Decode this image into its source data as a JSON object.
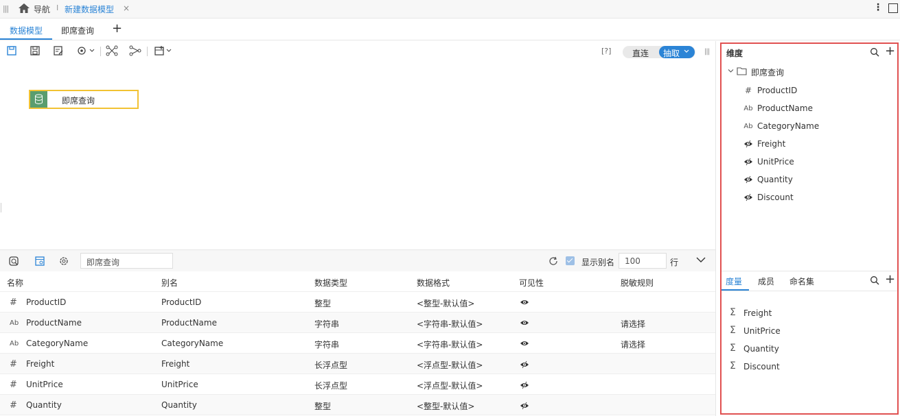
{
  "topbar": {
    "nav_label": "导航",
    "separator": "I",
    "open_tab": "新建数据模型",
    "close_glyph": "×"
  },
  "tabs": {
    "model": "数据模型",
    "adhoc": "即席查询",
    "add": "+"
  },
  "canvas": {
    "help": "[?]",
    "mode": {
      "direct": "直连",
      "extract": "抽取"
    },
    "node_label": "即席查询"
  },
  "bottom": {
    "search_value": "即席查询",
    "show_alias_label": "显示别名",
    "show_alias_checked": true,
    "row_limit": "100",
    "row_unit": "行",
    "columns": [
      "名称",
      "别名",
      "数据类型",
      "数据格式",
      "可见性",
      "脱敏规则"
    ],
    "rows": [
      {
        "icon": "hash-icon",
        "glyph": "#",
        "name": "ProductID",
        "alias": "ProductID",
        "type": "整型",
        "format": "<整型-默认值>",
        "visibility": "visible",
        "mask": ""
      },
      {
        "icon": "text-icon",
        "glyph": "Ab",
        "name": "ProductName",
        "alias": "ProductName",
        "type": "字符串",
        "format": "<字符串-默认值>",
        "visibility": "visible",
        "mask": "请选择"
      },
      {
        "icon": "text-icon",
        "glyph": "Ab",
        "name": "CategoryName",
        "alias": "CategoryName",
        "type": "字符串",
        "format": "<字符串-默认值>",
        "visibility": "visible",
        "mask": "请选择"
      },
      {
        "icon": "hash-icon",
        "glyph": "#",
        "name": "Freight",
        "alias": "Freight",
        "type": "长浮点型",
        "format": "<浮点型-默认值>",
        "visibility": "hidden",
        "mask": ""
      },
      {
        "icon": "hash-icon",
        "glyph": "#",
        "name": "UnitPrice",
        "alias": "UnitPrice",
        "type": "长浮点型",
        "format": "<浮点型-默认值>",
        "visibility": "hidden",
        "mask": ""
      },
      {
        "icon": "hash-icon",
        "glyph": "#",
        "name": "Quantity",
        "alias": "Quantity",
        "type": "整型",
        "format": "<整型-默认值>",
        "visibility": "hidden",
        "mask": ""
      }
    ]
  },
  "right_panel": {
    "dim_title": "维度",
    "folder": "即席查询",
    "dimensions": [
      {
        "icon": "hash-icon",
        "glyph": "#",
        "label": "ProductID"
      },
      {
        "icon": "text-icon",
        "glyph": "Ab",
        "label": "ProductName"
      },
      {
        "icon": "text-icon",
        "glyph": "Ab",
        "label": "CategoryName"
      },
      {
        "icon": "eye-hidden-icon",
        "glyph": "",
        "label": "Freight"
      },
      {
        "icon": "eye-hidden-icon",
        "glyph": "",
        "label": "UnitPrice"
      },
      {
        "icon": "eye-hidden-icon",
        "glyph": "",
        "label": "Quantity"
      },
      {
        "icon": "eye-hidden-icon",
        "glyph": "",
        "label": "Discount"
      }
    ],
    "measure_tabs": [
      "度量",
      "成员",
      "命名集"
    ],
    "measures": [
      "Freight",
      "UnitPrice",
      "Quantity",
      "Discount"
    ],
    "sigma": "Σ"
  },
  "colors": {
    "accent": "#2b84d6",
    "panel_border": "#e05050",
    "node_border": "#f2c233",
    "node_icon": "#5a9d6e"
  }
}
